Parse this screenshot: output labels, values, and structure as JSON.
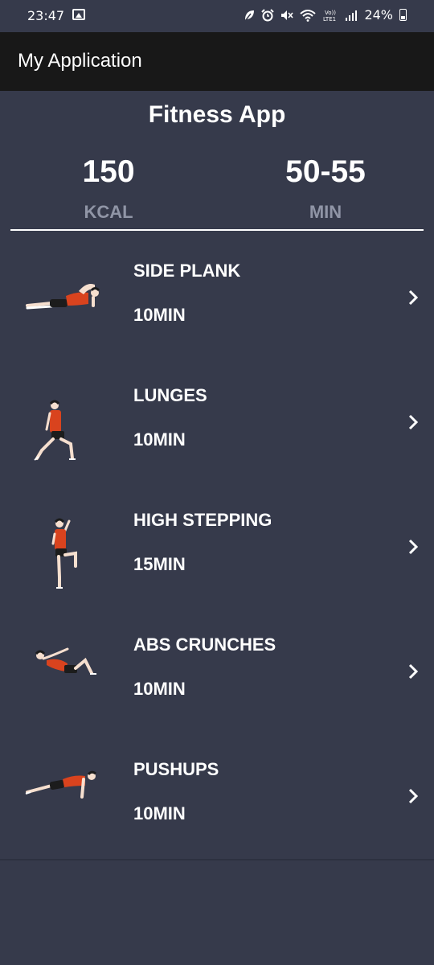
{
  "status_bar": {
    "time": "23:47",
    "battery": "24%",
    "icons": [
      "gallery-icon",
      "leaf-icon",
      "alarm-icon",
      "mute-icon",
      "wifi-icon",
      "volte-icon",
      "signal-icon",
      "battery-icon"
    ]
  },
  "app_bar": {
    "title": "My Application"
  },
  "header": {
    "title": "Fitness App",
    "stats": [
      {
        "value": "150",
        "unit": "KCAL"
      },
      {
        "value": "50-55",
        "unit": "MIN"
      }
    ]
  },
  "exercises": [
    {
      "name": "SIDE PLANK",
      "duration": "10MIN",
      "icon": "side-plank-illustration"
    },
    {
      "name": "LUNGES",
      "duration": "10MIN",
      "icon": "lunges-illustration"
    },
    {
      "name": "HIGH STEPPING",
      "duration": "15MIN",
      "icon": "high-stepping-illustration"
    },
    {
      "name": "ABS CRUNCHES",
      "duration": "10MIN",
      "icon": "abs-crunches-illustration"
    },
    {
      "name": "PUSHUPS",
      "duration": "10MIN",
      "icon": "pushups-illustration"
    }
  ],
  "colors": {
    "background": "#363a4b",
    "app_bar": "#181818",
    "muted_text": "#9095a6",
    "shirt": "#d9431e",
    "skin": "#f6dfcf",
    "shorts": "#1c1c1c"
  }
}
